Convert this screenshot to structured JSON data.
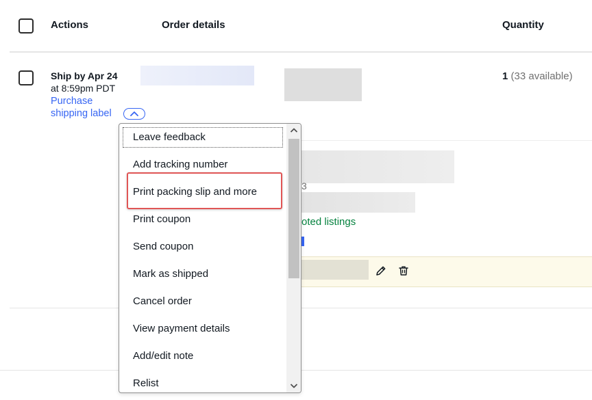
{
  "header": {
    "actions_label": "Actions",
    "order_details_label": "Order details",
    "quantity_label": "Quantity"
  },
  "order": {
    "ship_by": "Ship by Apr 24",
    "ship_time": "at 8:59pm PDT",
    "purchase_label": "Purchase shipping label",
    "quantity_value": "1",
    "quantity_available": " (33 available)",
    "partial_text_3": "3",
    "promoted_listings_fragment": "oted listings"
  },
  "menu": {
    "items": [
      "Leave feedback",
      "Add tracking number",
      "Print packing slip and more",
      "Print coupon",
      "Send coupon",
      "Mark as shipped",
      "Cancel order",
      "View payment details",
      "Add/edit note",
      "Relist"
    ],
    "highlighted_item": "Print packing slip and more"
  },
  "icons": {
    "toggle": "chevron-up-icon",
    "edit": "pencil-icon",
    "delete": "trash-icon",
    "scroll_up": "scroll-up-arrow-icon",
    "scroll_down": "scroll-down-arrow-icon"
  },
  "colors": {
    "link_blue": "#3665f3",
    "promo_green": "#05823f",
    "highlight_red": "#e05555",
    "note_bar": "#fdfaea"
  }
}
